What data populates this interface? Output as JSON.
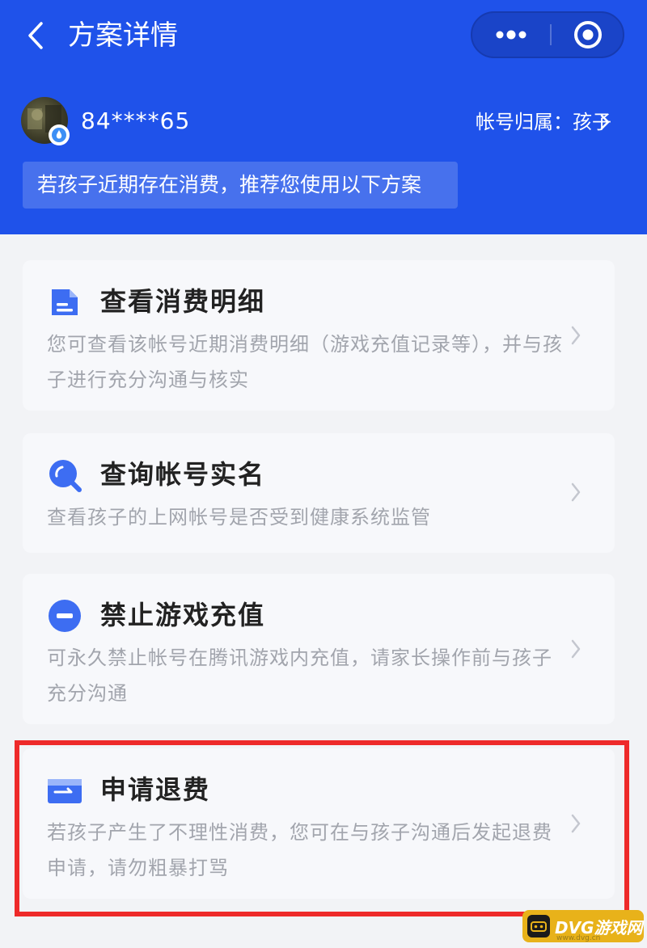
{
  "header": {
    "title": "方案详情",
    "account_id": "84****65",
    "owner_label": "帐号归属：孩子",
    "tip": "若孩子近期存在消费，推荐您使用以下方案"
  },
  "cards": [
    {
      "title": "查看消费明细",
      "desc": "您可查看该帐号近期消费明细（游戏充值记录等），并与孩子进行充分沟通与核实",
      "icon": "document-icon"
    },
    {
      "title": "查询帐号实名",
      "desc": "查看孩子的上网帐号是否受到健康系统监管",
      "icon": "search-icon"
    },
    {
      "title": "禁止游戏充值",
      "desc": "可永久禁止帐号在腾讯游戏内充值，请家长操作前与孩子充分沟通",
      "icon": "forbid-icon"
    },
    {
      "title": "申请退费",
      "desc": "若孩子产生了不理性消费，您可在与孩子沟通后发起退费申请，请勿粗暴打骂",
      "icon": "card-refund-icon"
    }
  ],
  "watermark": {
    "text": "DVG游戏网",
    "sub": "www.dvg.cn"
  },
  "colors": {
    "brand_blue": "#1f52ea",
    "highlight_red": "#ee2a2a",
    "icon_blue": "#3d6df2"
  }
}
